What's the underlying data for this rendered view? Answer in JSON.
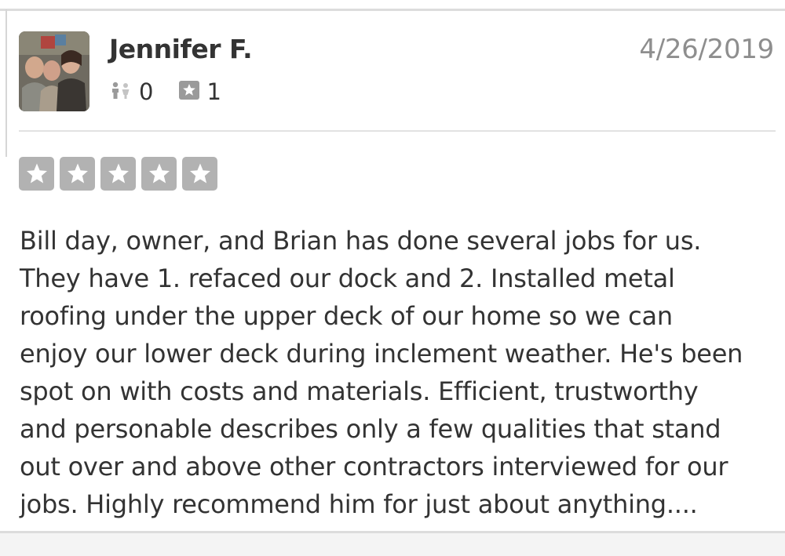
{
  "review": {
    "reviewer_name": "Jennifer F.",
    "date": "4/26/2019",
    "friends_count": "0",
    "reviews_count": "1",
    "rating": 5,
    "rating_max": 5,
    "text": "Bill day, owner, and Brian has done several jobs for us.\nThey have 1. refaced our dock and 2. Installed metal\nroofing under the upper deck of our home so we can\nenjoy our lower deck during inclement weather. He's been\nspot on with costs and materials.   Efficient, trustworthy\nand personable describes only a few qualities that stand\nout over and above other contractors interviewed for our\njobs.  Highly recommend him for just about anything...."
  },
  "icons": {
    "friends": "friends-icon",
    "reviews": "review-star-icon",
    "rating_star": "star-icon"
  },
  "colors": {
    "text": "#333333",
    "date": "#8e8e8e",
    "star_box": "#b2b2b2",
    "icon": "#9a9a9a",
    "divider": "#e2e2e2"
  }
}
